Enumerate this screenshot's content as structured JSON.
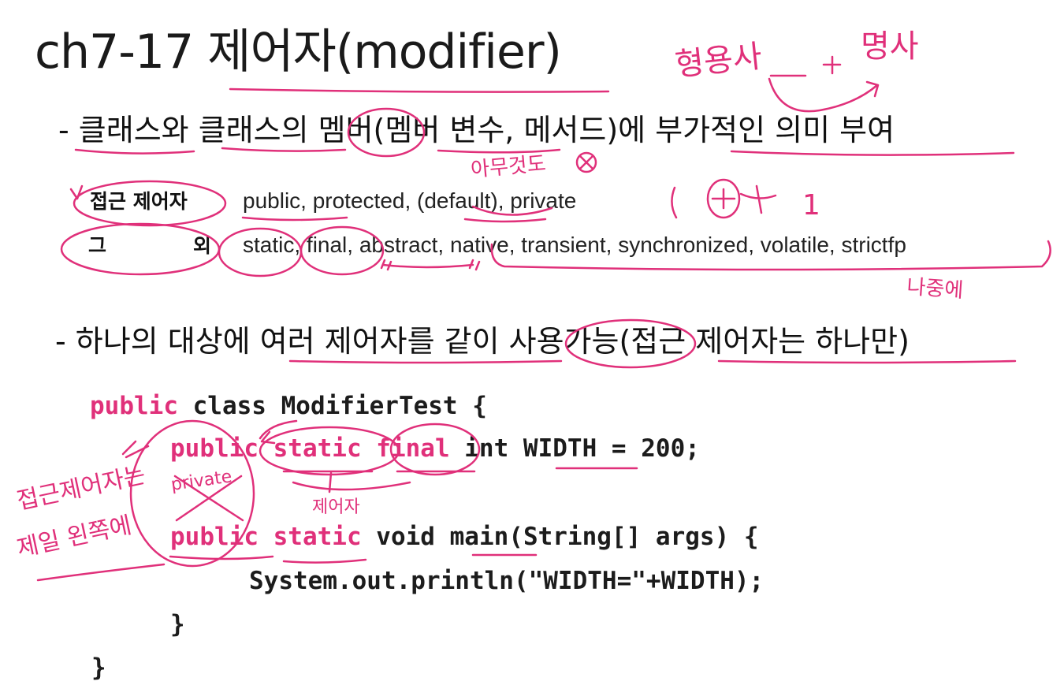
{
  "slide": {
    "title": "ch7-17 제어자(modifier)",
    "bullet_1": "- 클래스와 클래스의 멤버(멤버 변수, 메서드)에 부가적인 의미 부여",
    "bullet_2": "- 하나의 대상에 여러 제어자를 같이 사용가능(접근 제어자는 하나만)"
  },
  "modifier_table": {
    "access_label": "접근 제어자",
    "access_value": "public, protected, (default), private",
    "other_label_1": "그",
    "other_label_2": "외",
    "other_value": "static, final, abstract, native, transient, synchronized, volatile, strictfp"
  },
  "code": {
    "line_1": {
      "kw": "public",
      "rest": " class ModifierTest {"
    },
    "line_2": {
      "kw": "public static final",
      "rest": " int WIDTH = 200;"
    },
    "line_3": {
      "kw": "public static",
      "rest": " void main(String[] args) {"
    },
    "line_4": "System.out.println(\"WIDTH=\"+WIDTH);",
    "line_5": "}",
    "line_6": "}"
  },
  "annotations": {
    "adjective_noun_1": "형용사",
    "adjective_noun_2": "명사",
    "nothing_written": "아무것도",
    "count_one": "1",
    "all_of_them": "나중에",
    "private_crossed": "private",
    "modifier": "제어자",
    "access_first_1": "접근제어자는",
    "access_first_2": "제일 왼쪽에"
  },
  "colors": {
    "ink": "#e0307a",
    "keyword": "#e0307a",
    "text": "#111111"
  }
}
